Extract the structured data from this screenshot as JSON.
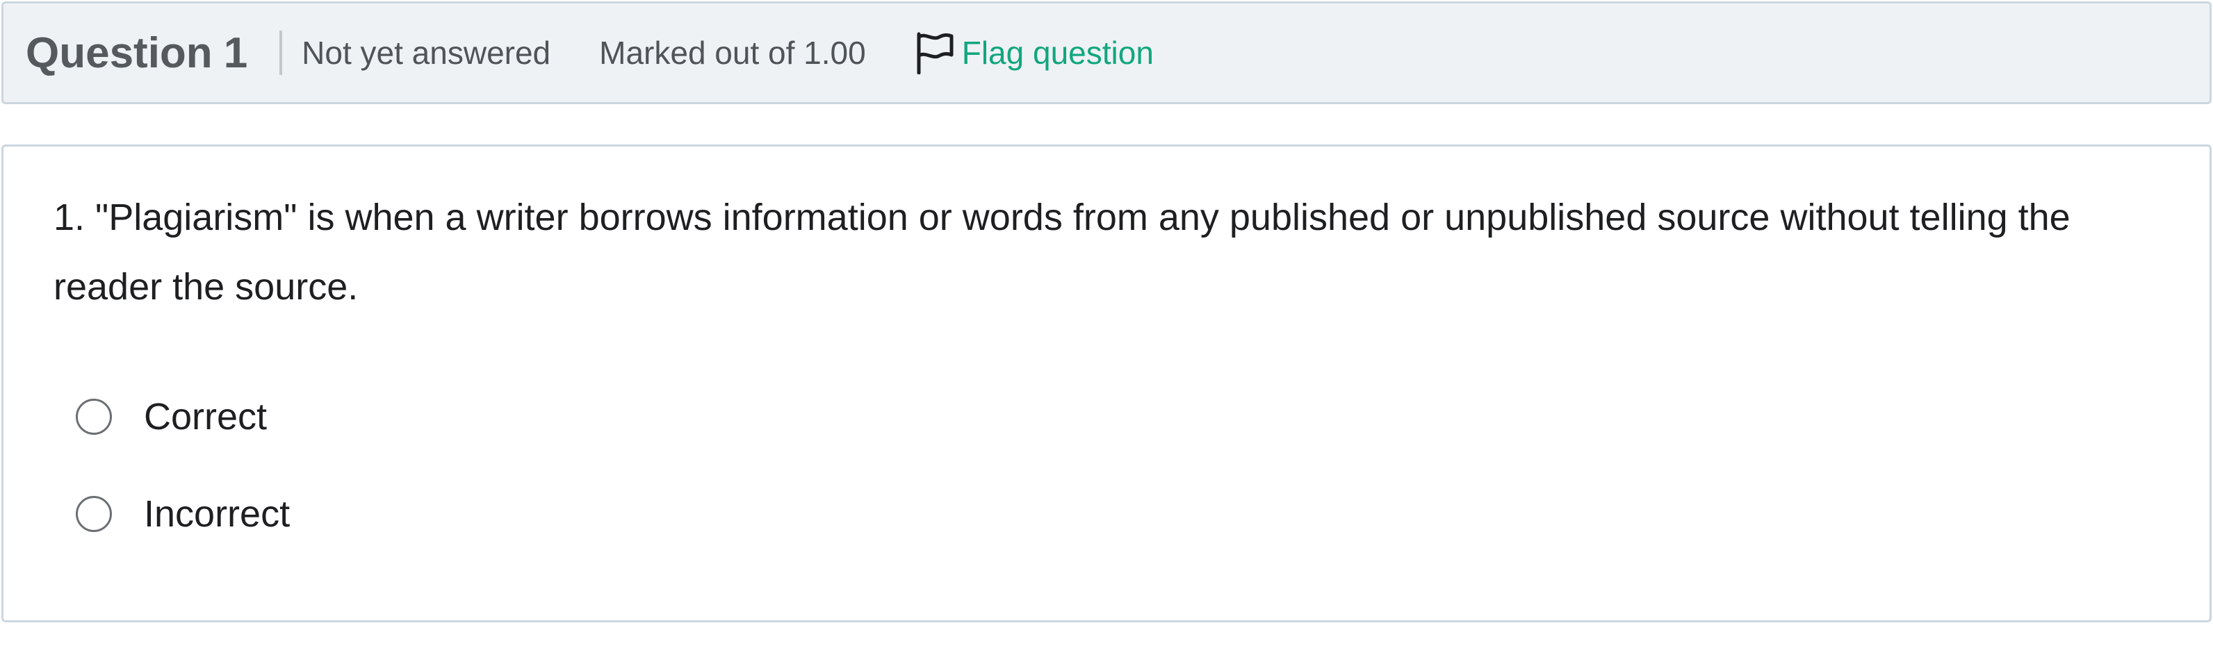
{
  "question": {
    "title_word": "Question",
    "number": "1",
    "state": "Not yet answered",
    "grade": "Marked out of 1.00",
    "flag_label": "Flag question",
    "flag_icon": "flag-outline-icon",
    "text": "1. \"Plagiarism\" is when a writer borrows information or words from any published or unpublished source without telling the reader the source.",
    "answers": [
      {
        "label": "Correct",
        "selected": false
      },
      {
        "label": "Incorrect",
        "selected": false
      }
    ]
  },
  "colors": {
    "header_background": "#eef2f5",
    "border": "#cdd6e0",
    "link_accent": "#12a67e",
    "muted_text": "#4f5458",
    "body_text": "#1d1f21"
  }
}
